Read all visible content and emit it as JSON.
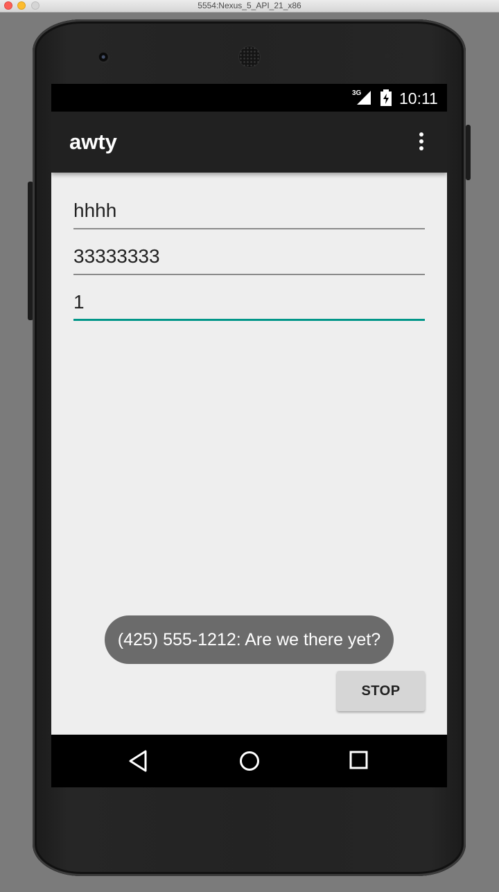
{
  "window": {
    "title": "5554:Nexus_5_API_21_x86"
  },
  "status_bar": {
    "network": "3G",
    "time": "10:11",
    "icons": [
      "signal-icon",
      "battery-charging-icon"
    ]
  },
  "app_bar": {
    "title": "awty",
    "menu_icon": "overflow-menu-icon"
  },
  "form": {
    "fields": [
      {
        "value": "hhhh"
      },
      {
        "value": "33333333"
      },
      {
        "value": "1"
      }
    ]
  },
  "toast": {
    "message": "(425) 555-1212: Are we there yet?"
  },
  "actions": {
    "stop_label": "STOP"
  },
  "nav_bar": {
    "icons": [
      "back-icon",
      "home-icon",
      "recents-icon"
    ]
  },
  "colors": {
    "accent": "#009688",
    "app_bar": "#212121",
    "background": "#eeeeee"
  }
}
